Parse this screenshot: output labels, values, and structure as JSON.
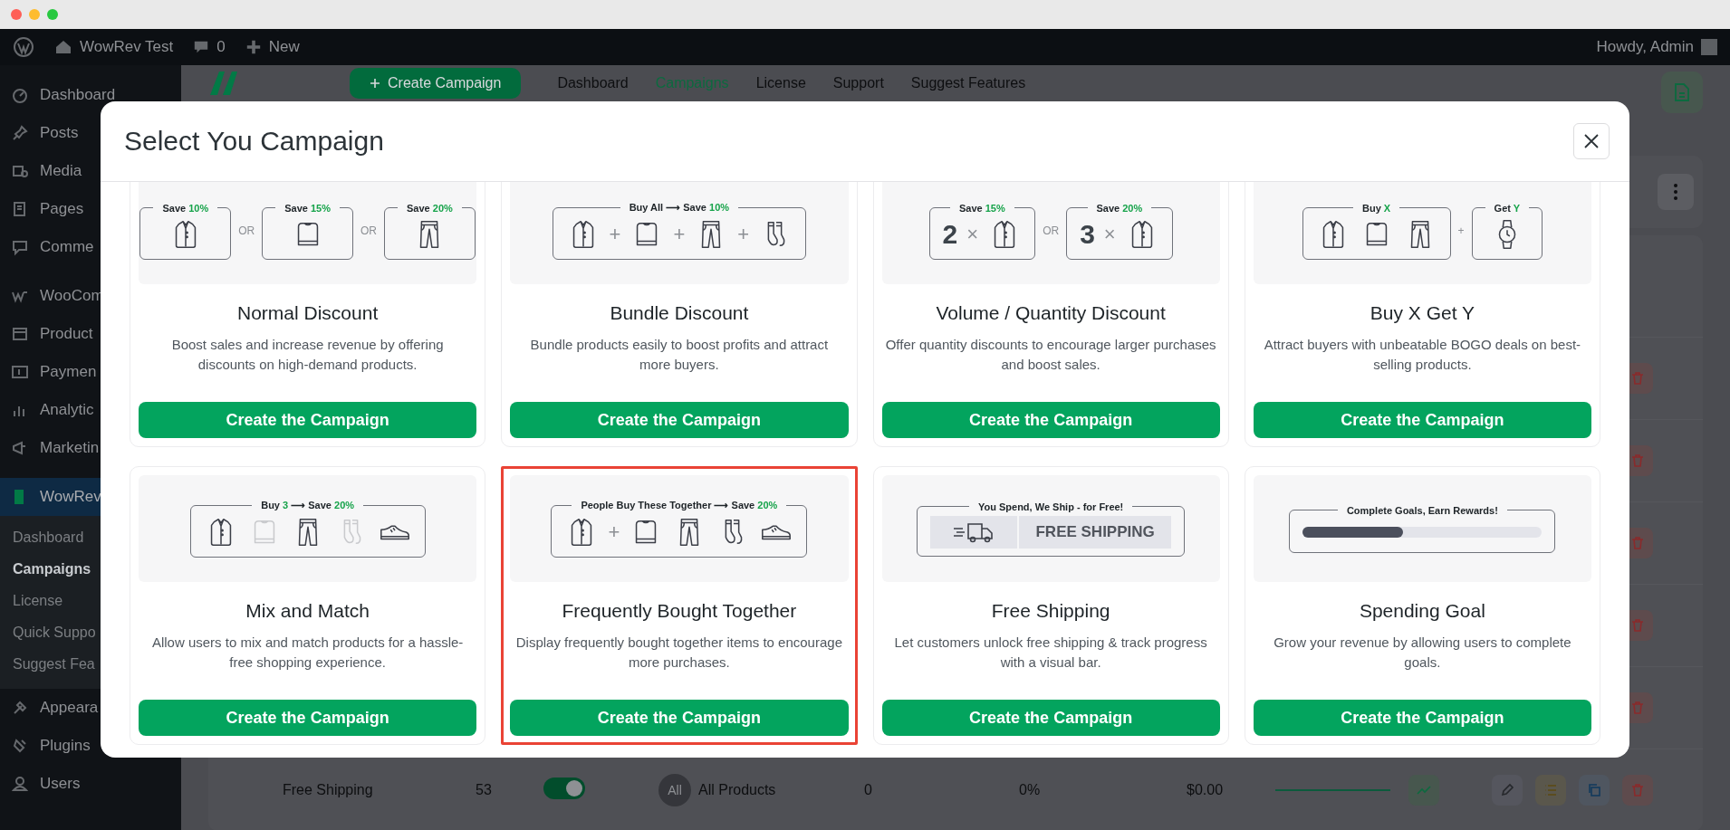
{
  "admin_bar": {
    "site_name": "WowRev Test",
    "comments_count": "0",
    "new_label": "New",
    "greeting": "Howdy, Admin"
  },
  "sidebar": {
    "items": [
      {
        "label": "Dashboard",
        "selected": false
      },
      {
        "label": "Posts",
        "selected": false
      },
      {
        "label": "Media",
        "selected": false
      },
      {
        "label": "Pages",
        "selected": false
      },
      {
        "label": "Comme",
        "selected": false
      },
      {
        "label": "WooCom",
        "selected": false
      },
      {
        "label": "Product",
        "selected": false
      },
      {
        "label": "Paymen",
        "selected": false
      },
      {
        "label": "Analytic",
        "selected": false
      },
      {
        "label": "Marketin",
        "selected": false
      },
      {
        "label": "WowRev",
        "selected": true,
        "children": [
          {
            "label": "Dashboard",
            "selected": false
          },
          {
            "label": "Campaigns",
            "selected": true
          },
          {
            "label": "License",
            "selected": false
          },
          {
            "label": "Quick Suppo",
            "selected": false
          },
          {
            "label": "Suggest Fea",
            "selected": false
          }
        ]
      },
      {
        "label": "Appeara",
        "selected": false
      },
      {
        "label": "Plugins",
        "selected": false
      },
      {
        "label": "Users",
        "selected": false
      }
    ]
  },
  "plugin_header": {
    "create_button": "Create Campaign",
    "nav": [
      {
        "label": "Dashboard",
        "selected": false
      },
      {
        "label": "Campaigns",
        "selected": true
      },
      {
        "label": "License",
        "selected": false
      },
      {
        "label": "Support",
        "selected": false
      },
      {
        "label": "Suggest Features",
        "selected": false
      }
    ]
  },
  "table": {
    "rows": [
      {
        "name": "Free Shipping",
        "count": "53",
        "enabled": true,
        "badge": "All",
        "target": "All Products",
        "column_5": "0",
        "column_6": "0%",
        "column_7": "$0.00"
      }
    ]
  },
  "modal": {
    "title": "Select You Campaign",
    "cards": [
      {
        "title": "Normal Discount",
        "description": "Boost sales and increase revenue by offering discounts on high-demand products.",
        "button": "Create the Campaign",
        "highlighted": false,
        "illustration": [
          {
            "kind": "box",
            "label": [
              {
                "text": "Save ",
                "accent": false
              },
              {
                "text": "10%",
                "accent": true
              }
            ],
            "items": [
              {
                "kind": "shirt"
              }
            ]
          },
          {
            "kind": "separator",
            "text": "OR"
          },
          {
            "kind": "box",
            "label": [
              {
                "text": "Save ",
                "accent": false
              },
              {
                "text": "15%",
                "accent": true
              }
            ],
            "items": [
              {
                "kind": "sweater"
              }
            ]
          },
          {
            "kind": "separator",
            "text": "OR"
          },
          {
            "kind": "box",
            "label": [
              {
                "text": "Save ",
                "accent": false
              },
              {
                "text": "20%",
                "accent": true
              }
            ],
            "items": [
              {
                "kind": "pants"
              }
            ]
          }
        ]
      },
      {
        "title": "Bundle Discount",
        "description": "Bundle products easily to boost profits and attract more buyers.",
        "button": "Create the Campaign",
        "highlighted": false,
        "illustration": [
          {
            "kind": "box",
            "label": [
              {
                "text": "Buy All ⟶ Save ",
                "accent": false
              },
              {
                "text": "10%",
                "accent": true
              }
            ],
            "items": [
              {
                "kind": "shirt"
              },
              {
                "kind": "sign",
                "text": "+"
              },
              {
                "kind": "sweater"
              },
              {
                "kind": "sign",
                "text": "+"
              },
              {
                "kind": "pants"
              },
              {
                "kind": "sign",
                "text": "+"
              },
              {
                "kind": "socks"
              }
            ]
          }
        ]
      },
      {
        "title": "Volume / Quantity Discount",
        "description": "Offer quantity discounts to encourage larger purchases and boost sales.",
        "button": "Create the Campaign",
        "highlighted": false,
        "illustration": [
          {
            "kind": "box",
            "label": [
              {
                "text": "Save ",
                "accent": false
              },
              {
                "text": "15%",
                "accent": true
              }
            ],
            "items": [
              {
                "kind": "number",
                "text": "2"
              },
              {
                "kind": "sign",
                "text": "×"
              },
              {
                "kind": "shirt"
              }
            ]
          },
          {
            "kind": "separator",
            "text": "OR"
          },
          {
            "kind": "box",
            "label": [
              {
                "text": "Save ",
                "accent": false
              },
              {
                "text": "20%",
                "accent": true
              }
            ],
            "items": [
              {
                "kind": "number",
                "text": "3"
              },
              {
                "kind": "sign",
                "text": "×"
              },
              {
                "kind": "shirt"
              }
            ]
          }
        ]
      },
      {
        "title": "Buy X Get Y",
        "description": "Attract buyers with unbeatable BOGO deals on best-selling products.",
        "button": "Create the Campaign",
        "highlighted": false,
        "illustration": [
          {
            "kind": "box",
            "label": [
              {
                "text": "Buy ",
                "accent": false
              },
              {
                "text": "X",
                "accent": true
              }
            ],
            "items": [
              {
                "kind": "shirt"
              },
              {
                "kind": "sweater"
              },
              {
                "kind": "pants"
              }
            ]
          },
          {
            "kind": "separator",
            "text": "+"
          },
          {
            "kind": "box",
            "label": [
              {
                "text": "Get ",
                "accent": false
              },
              {
                "text": "Y",
                "accent": true
              }
            ],
            "items": [
              {
                "kind": "watch"
              }
            ]
          }
        ]
      },
      {
        "title": "Mix and Match",
        "description": "Allow users to mix and match products for a hassle-free shopping experience.",
        "button": "Create the Campaign",
        "highlighted": false,
        "illustration": [
          {
            "kind": "box",
            "label": [
              {
                "text": "Buy ",
                "accent": false
              },
              {
                "text": "3",
                "accent": true
              },
              {
                "text": " ⟶ Save ",
                "accent": false
              },
              {
                "text": "20%",
                "accent": true
              }
            ],
            "items": [
              {
                "kind": "shirt",
                "faded": false
              },
              {
                "kind": "sweater",
                "faded": true
              },
              {
                "kind": "pants",
                "faded": false
              },
              {
                "kind": "socks",
                "faded": true
              },
              {
                "kind": "shoe",
                "faded": false
              }
            ]
          }
        ]
      },
      {
        "title": "Frequently Bought Together",
        "description": "Display frequently bought together items to encourage more purchases.",
        "button": "Create the Campaign",
        "highlighted": true,
        "illustration": [
          {
            "kind": "box",
            "label": [
              {
                "text": "People Buy These Together ⟶ Save ",
                "accent": false
              },
              {
                "text": "20%",
                "accent": true
              }
            ],
            "items": [
              {
                "kind": "shirt"
              },
              {
                "kind": "sign",
                "text": "+"
              },
              {
                "kind": "sweater"
              },
              {
                "kind": "pants"
              },
              {
                "kind": "socks"
              },
              {
                "kind": "shoe"
              }
            ]
          }
        ]
      },
      {
        "title": "Free Shipping",
        "description": "Let customers unlock free shipping & track progress with a visual bar.",
        "button": "Create the Campaign",
        "highlighted": false,
        "illustration": [
          {
            "kind": "box",
            "label": [
              {
                "text": "You Spend, We Ship - for Free!",
                "accent": false
              }
            ],
            "items": [
              {
                "kind": "shipping-bar",
                "text": "FREE SHIPPING"
              }
            ]
          }
        ]
      },
      {
        "title": "Spending Goal",
        "description": "Grow your revenue by allowing users to complete goals.",
        "button": "Create the Campaign",
        "highlighted": false,
        "illustration": [
          {
            "kind": "box",
            "label": [
              {
                "text": "Complete Goals, Earn Rewards!",
                "accent": false
              }
            ],
            "items": [
              {
                "kind": "progress",
                "level": 0.42
              }
            ]
          }
        ]
      }
    ]
  }
}
